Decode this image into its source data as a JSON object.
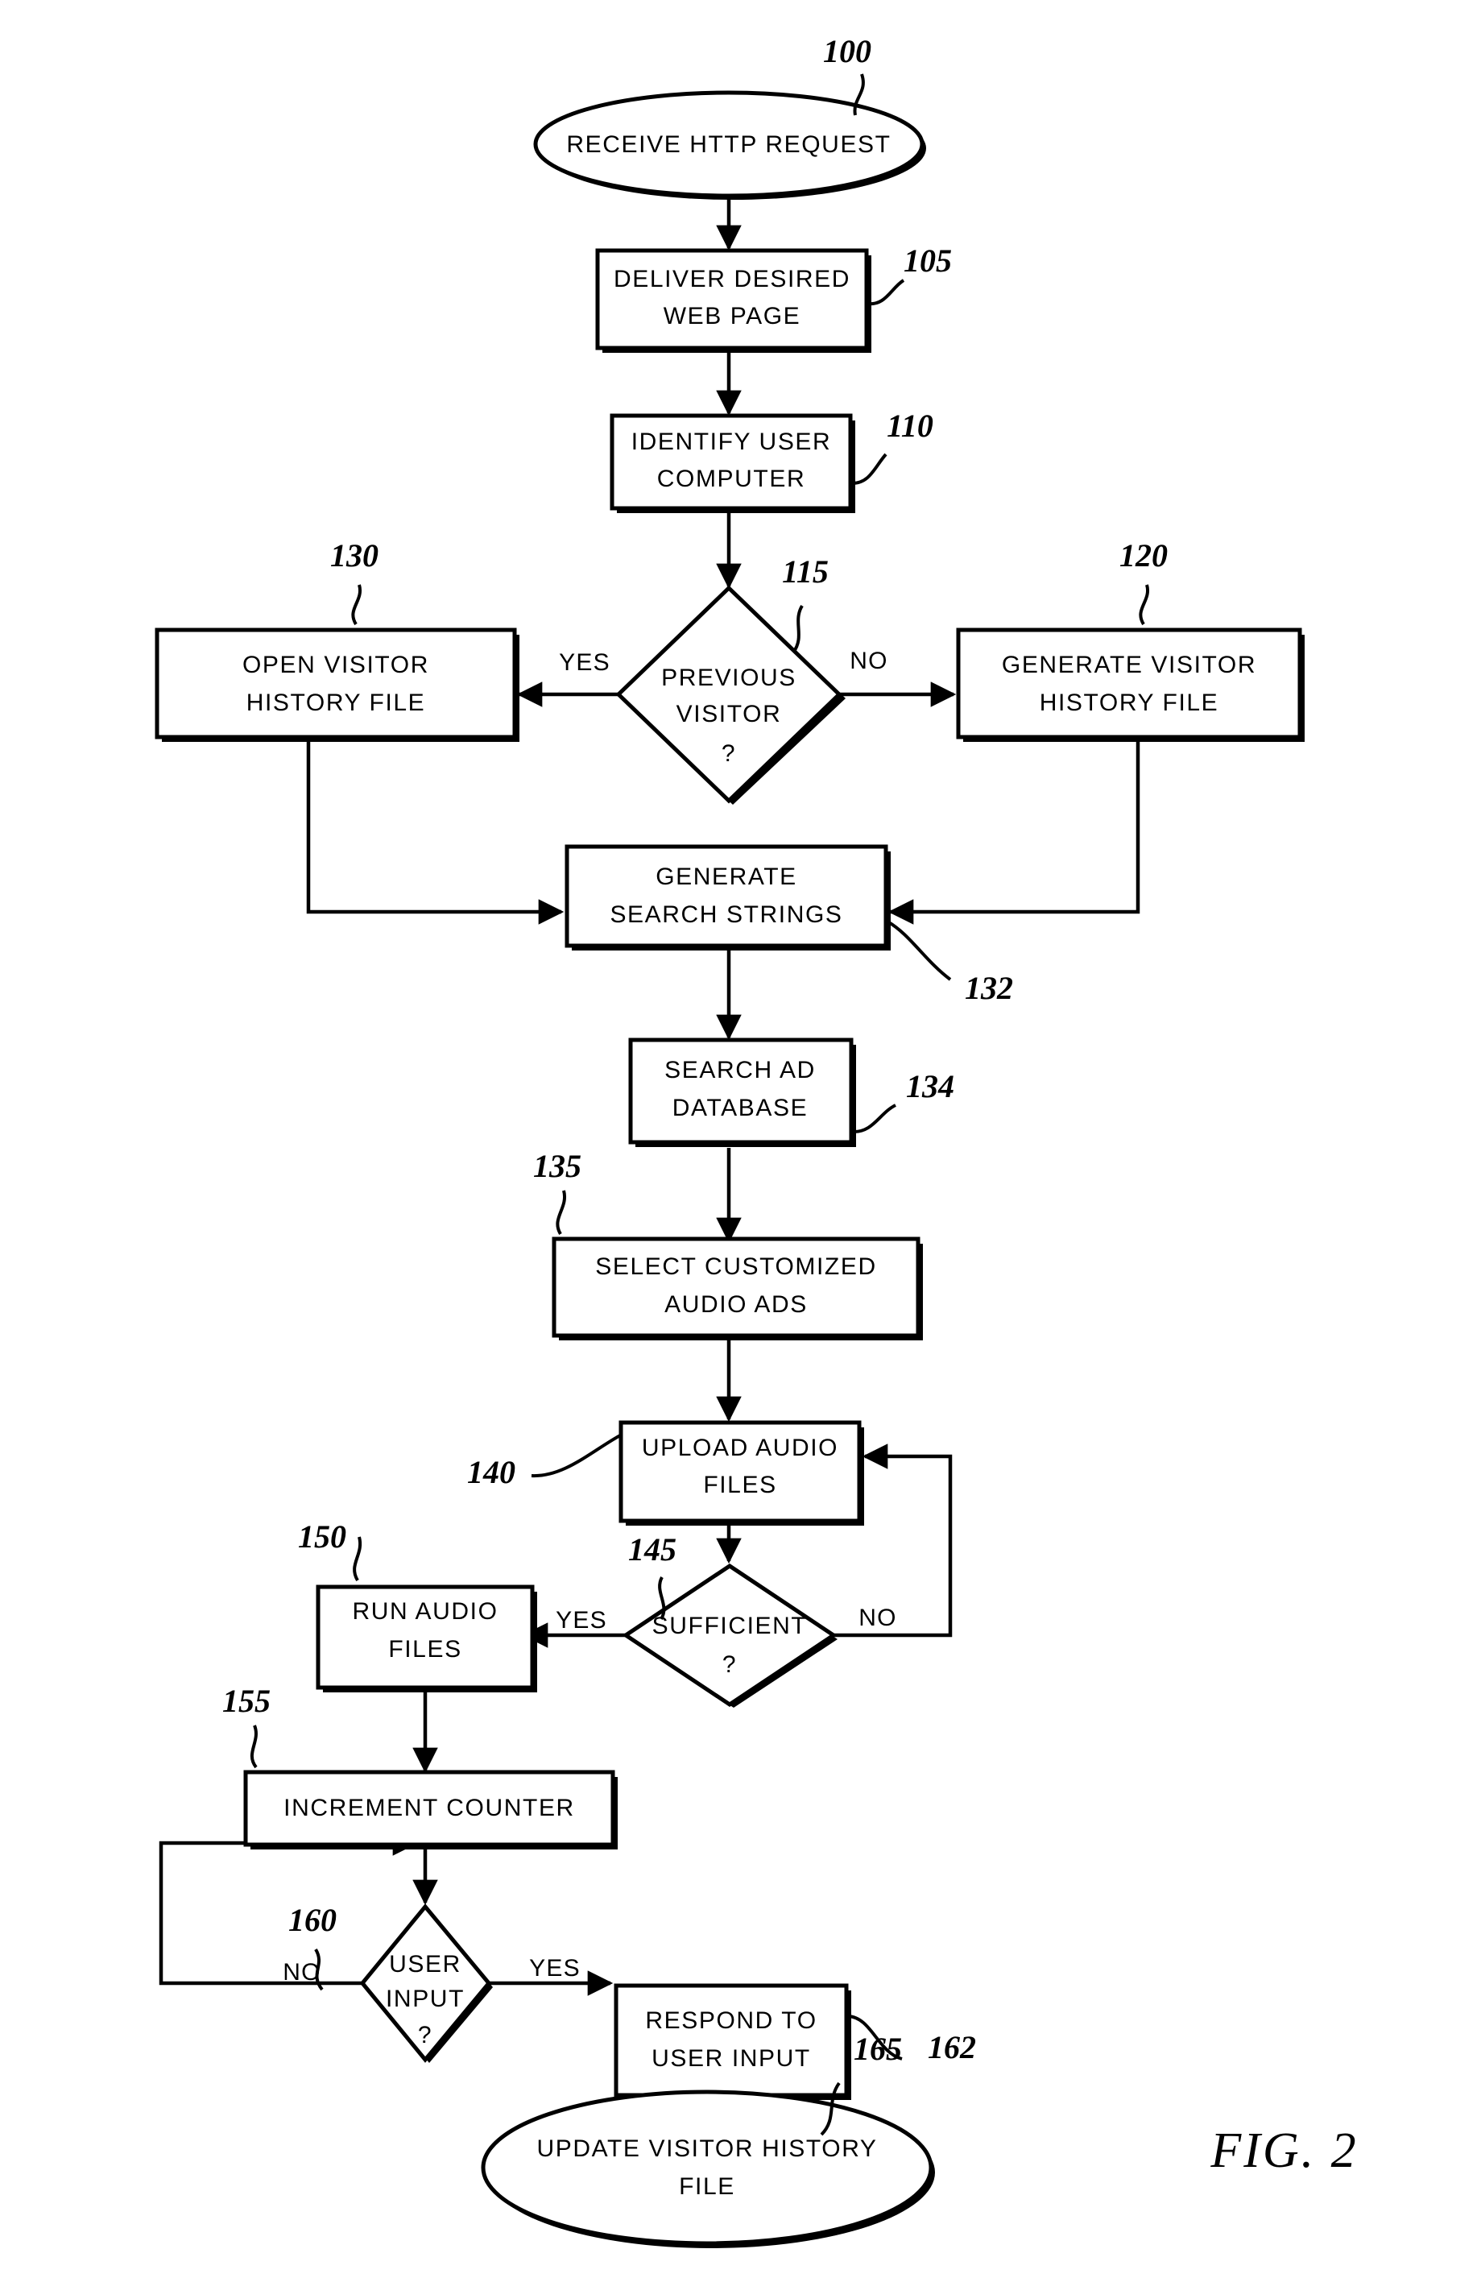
{
  "figure": {
    "caption": "FIG.  2",
    "background_color": "#ffffff",
    "ink_color": "#000000"
  },
  "chart_data": {
    "type": "diagram",
    "diagram_kind": "flowchart",
    "title": "FIG.  2",
    "nodes": [
      {
        "ref": "100",
        "shape": "terminator",
        "lines": [
          "RECEIVE HTTP REQUEST"
        ],
        "text": "RECEIVE HTTP REQUEST"
      },
      {
        "ref": "105",
        "shape": "process",
        "lines": [
          "DELIVER DESIRED",
          "WEB PAGE"
        ],
        "text": "DELIVER DESIRED WEB PAGE"
      },
      {
        "ref": "110",
        "shape": "process",
        "lines": [
          "IDENTIFY USER",
          "COMPUTER"
        ],
        "text": "IDENTIFY USER COMPUTER"
      },
      {
        "ref": "115",
        "shape": "decision",
        "lines": [
          "PREVIOUS",
          "VISITOR",
          "?"
        ],
        "text": "PREVIOUS VISITOR ?"
      },
      {
        "ref": "120",
        "shape": "process",
        "lines": [
          "GENERATE VISITOR",
          "HISTORY FILE"
        ],
        "text": "GENERATE VISITOR HISTORY FILE"
      },
      {
        "ref": "130",
        "shape": "process",
        "lines": [
          "OPEN VISITOR",
          "HISTORY FILE"
        ],
        "text": "OPEN VISITOR HISTORY FILE"
      },
      {
        "ref": "132",
        "shape": "process",
        "lines": [
          "GENERATE",
          "SEARCH STRINGS"
        ],
        "text": "GENERATE SEARCH STRINGS"
      },
      {
        "ref": "134",
        "shape": "process",
        "lines": [
          "SEARCH AD",
          "DATABASE"
        ],
        "text": "SEARCH AD DATABASE"
      },
      {
        "ref": "135",
        "shape": "process",
        "lines": [
          "SELECT CUSTOMIZED",
          "AUDIO ADS"
        ],
        "text": "SELECT CUSTOMIZED AUDIO ADS"
      },
      {
        "ref": "140",
        "shape": "process",
        "lines": [
          "UPLOAD AUDIO",
          "FILES"
        ],
        "text": "UPLOAD AUDIO FILES"
      },
      {
        "ref": "145",
        "shape": "decision",
        "lines": [
          "SUFFICIENT",
          "?"
        ],
        "text": "SUFFICIENT ?"
      },
      {
        "ref": "150",
        "shape": "process",
        "lines": [
          "RUN AUDIO",
          "FILES"
        ],
        "text": "RUN AUDIO FILES"
      },
      {
        "ref": "155",
        "shape": "process",
        "lines": [
          "INCREMENT COUNTER"
        ],
        "text": "INCREMENT COUNTER"
      },
      {
        "ref": "160",
        "shape": "decision",
        "lines": [
          "USER",
          "INPUT",
          "?"
        ],
        "text": "USER INPUT ?"
      },
      {
        "ref": "162",
        "shape": "process",
        "lines": [
          "RESPOND TO",
          "USER INPUT"
        ],
        "text": "RESPOND TO USER INPUT"
      },
      {
        "ref": "165",
        "shape": "terminator",
        "lines": [
          "UPDATE VISITOR HISTORY",
          "FILE"
        ],
        "text": "UPDATE VISITOR HISTORY FILE"
      }
    ],
    "edges": [
      {
        "from": "100",
        "to": "105",
        "label": ""
      },
      {
        "from": "105",
        "to": "110",
        "label": ""
      },
      {
        "from": "110",
        "to": "115",
        "label": ""
      },
      {
        "from": "115",
        "to": "130",
        "label": "YES"
      },
      {
        "from": "115",
        "to": "120",
        "label": "NO"
      },
      {
        "from": "130",
        "to": "132",
        "label": ""
      },
      {
        "from": "120",
        "to": "132",
        "label": ""
      },
      {
        "from": "132",
        "to": "134",
        "label": ""
      },
      {
        "from": "134",
        "to": "135",
        "label": ""
      },
      {
        "from": "135",
        "to": "140",
        "label": ""
      },
      {
        "from": "140",
        "to": "145",
        "label": ""
      },
      {
        "from": "145",
        "to": "150",
        "label": "YES"
      },
      {
        "from": "145",
        "to": "140",
        "label": "NO"
      },
      {
        "from": "150",
        "to": "155",
        "label": ""
      },
      {
        "from": "155",
        "to": "160",
        "label": ""
      },
      {
        "from": "160",
        "to": "162",
        "label": "YES"
      },
      {
        "from": "160",
        "to": "160",
        "label": "NO"
      },
      {
        "from": "162",
        "to": "165",
        "label": ""
      }
    ]
  },
  "nodes": {
    "n100": {
      "ref": "100",
      "l1": "RECEIVE HTTP REQUEST"
    },
    "n105": {
      "ref": "105",
      "l1": "DELIVER DESIRED",
      "l2": "WEB PAGE"
    },
    "n110": {
      "ref": "110",
      "l1": "IDENTIFY USER",
      "l2": "COMPUTER"
    },
    "n115": {
      "ref": "115",
      "l1": "PREVIOUS",
      "l2": "VISITOR",
      "l3": "?",
      "yes": "YES",
      "no": "NO"
    },
    "n120": {
      "ref": "120",
      "l1": "GENERATE VISITOR",
      "l2": "HISTORY FILE"
    },
    "n130": {
      "ref": "130",
      "l1": "OPEN VISITOR",
      "l2": "HISTORY FILE"
    },
    "n132": {
      "ref": "132",
      "l1": "GENERATE",
      "l2": "SEARCH STRINGS"
    },
    "n134": {
      "ref": "134",
      "l1": "SEARCH AD",
      "l2": "DATABASE"
    },
    "n135": {
      "ref": "135",
      "l1": "SELECT CUSTOMIZED",
      "l2": "AUDIO ADS"
    },
    "n140": {
      "ref": "140",
      "l1": "UPLOAD AUDIO",
      "l2": "FILES"
    },
    "n145": {
      "ref": "145",
      "l1": "SUFFICIENT",
      "l2": "?",
      "yes": "YES",
      "no": "NO"
    },
    "n150": {
      "ref": "150",
      "l1": "RUN AUDIO",
      "l2": "FILES"
    },
    "n155": {
      "ref": "155",
      "l1": "INCREMENT COUNTER"
    },
    "n160": {
      "ref": "160",
      "l1": "USER",
      "l2": "INPUT",
      "l3": "?",
      "yes": "YES",
      "no": "NO"
    },
    "n162": {
      "ref": "162",
      "l1": "RESPOND TO",
      "l2": "USER INPUT"
    },
    "n165": {
      "ref": "165",
      "l1": "UPDATE VISITOR HISTORY",
      "l2": "FILE"
    }
  }
}
